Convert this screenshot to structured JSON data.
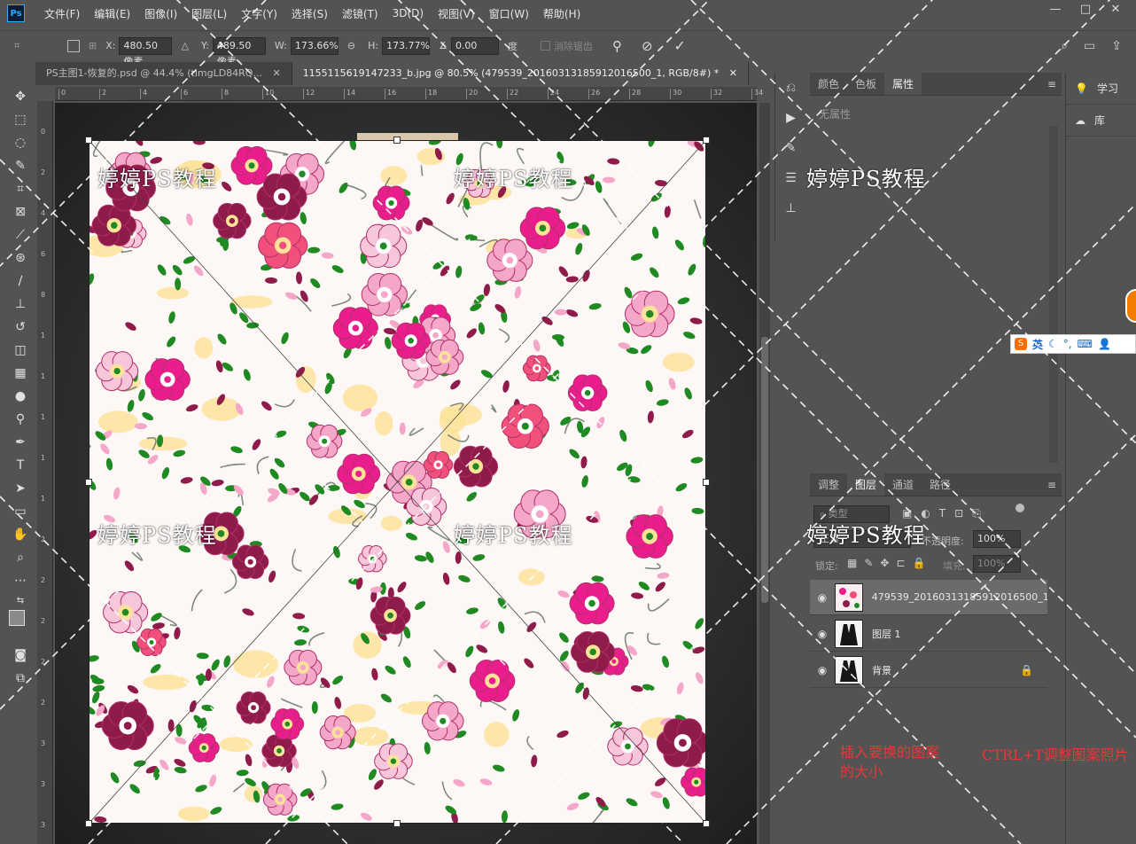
{
  "menubar": {
    "logo": "Ps",
    "items": [
      "文件(F)",
      "编辑(E)",
      "图像(I)",
      "图层(L)",
      "文字(Y)",
      "选择(S)",
      "滤镜(T)",
      "3D(D)",
      "视图(V)",
      "窗口(W)",
      "帮助(H)"
    ],
    "window_controls": [
      "—",
      "□",
      "✕"
    ]
  },
  "options": {
    "x_label": "X:",
    "x_value": "480.50 像素",
    "y_label": "Y:",
    "y_value": "489.50 像素",
    "w_label": "W:",
    "w_value": "173.66%",
    "h_label": "H:",
    "h_value": "173.77%",
    "angle_value": "0.00",
    "angle_unit": "度",
    "antialias_label": "消除锯齿"
  },
  "tabs": [
    {
      "label": "PS主图1-恢复的.psd @ 44.4% (timgLD84RQ...",
      "close": "✕"
    },
    {
      "label": "1155115619147233_b.jpg @ 80.5% (479539_20160313185912016500_1, RGB/8#) *",
      "close": "✕"
    }
  ],
  "ruler": {
    "top_ticks": [
      "0",
      "2",
      "4",
      "6",
      "8",
      "10",
      "12",
      "14",
      "16",
      "18",
      "20",
      "22",
      "24",
      "26",
      "28",
      "30",
      "32",
      "34"
    ],
    "left_ticks": [
      "0",
      "2",
      "4",
      "6",
      "8",
      "1",
      "1",
      "1",
      "1",
      "1",
      "2",
      "2",
      "2",
      "2",
      "2",
      "3",
      "3",
      "3"
    ]
  },
  "props_panel": {
    "tabs": [
      "颜色",
      "色板",
      "属性"
    ],
    "active_tab": 2,
    "no_properties": "无属性"
  },
  "layers_panel": {
    "tabs": [
      "调整",
      "图层",
      "通道",
      "路径"
    ],
    "active_tab": 1,
    "filter_placeholder": "类型",
    "blend_mode": "正常",
    "opacity_label": "不透明度:",
    "opacity_value": "100%",
    "lock_label": "锁定:",
    "fill_label": "填充:",
    "fill_value": "100%",
    "layers": [
      {
        "name": "479539_20160313185912016500_1",
        "selected": true,
        "type": "floral"
      },
      {
        "name": "图层 1",
        "selected": false,
        "type": "suit"
      },
      {
        "name": "背景",
        "selected": false,
        "type": "suit-bg",
        "locked": true
      }
    ]
  },
  "learn_col": {
    "items": [
      {
        "icon": "lightbulb-icon",
        "label": "学习"
      },
      {
        "icon": "cloud-icon",
        "label": "库"
      }
    ]
  },
  "watermarks": [
    "婷婷PS教程",
    "婷婷PS教程",
    "婷婷PS教程",
    "婷婷PS教程",
    "婷婷PS教程",
    "婷婷PS教程",
    "婷婷PS教程"
  ],
  "annotation": {
    "note_a": "插入要换的图案的大小",
    "note_a_line1": "插入要换的图案",
    "note_a_line2": "的大小",
    "note_b": "CTRL+T调整图案照片"
  },
  "ime": {
    "logo": "S",
    "mode": "英",
    "icons": [
      "moon-icon",
      "punctuation-icon",
      "keyboard-icon",
      "user-icon"
    ]
  },
  "colors": {
    "accent_red": "#e53935",
    "ps_blue": "#31a8ff",
    "magenta": "#e91e8c",
    "rose": "#f0507a",
    "maroon": "#8e1b4a",
    "leaf": "#1f8a22",
    "cream": "#fde39a",
    "pink": "#f4a7c8"
  }
}
